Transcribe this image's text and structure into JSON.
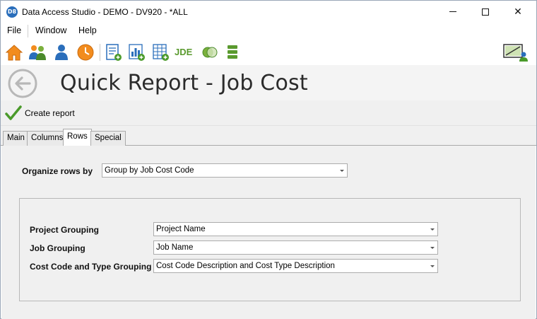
{
  "window": {
    "app_icon_text": "D8",
    "title": "Data Access Studio - DEMO - DV920 - *ALL",
    "close_glyph": "✕"
  },
  "menu": {
    "items": [
      "File",
      "Window",
      "Help"
    ]
  },
  "toolbar": {
    "jde_label": "JDE",
    "icons": [
      "home-icon",
      "users-icon",
      "user-icon",
      "clock-icon",
      "new-document-report-icon",
      "new-chart-report-icon",
      "new-grid-report-icon",
      "jde-icon",
      "venn-icon",
      "list-icon",
      "presentation-icon"
    ]
  },
  "header": {
    "title": "Quick Report - Job Cost"
  },
  "actions": {
    "create_report": "Create report"
  },
  "tabs": [
    {
      "label": "Main",
      "active": false
    },
    {
      "label": "Columns",
      "active": false
    },
    {
      "label": "Rows",
      "active": true
    },
    {
      "label": "Special",
      "active": false
    }
  ],
  "rows": {
    "organize_label": "Organize rows by",
    "organize_value": "Group by Job Cost Code",
    "project_label": "Project Grouping",
    "project_value": "Project Name",
    "job_label": "Job Grouping",
    "job_value": "Job Name",
    "costcode_label": "Cost Code and Type Grouping",
    "costcode_value": "Cost Code Description and Cost Type Description"
  },
  "colors": {
    "accent_blue": "#2a6ebb",
    "home_orange": "#f28c1e",
    "check_green": "#4a9a2a",
    "jde_green": "#5a9a2e"
  }
}
